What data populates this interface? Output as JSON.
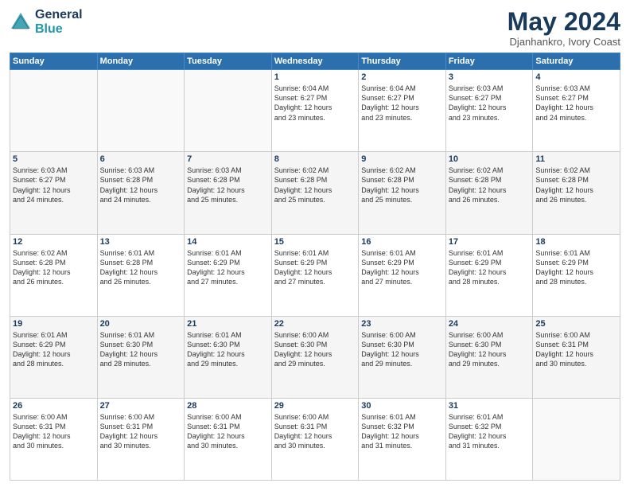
{
  "logo": {
    "line1": "General",
    "line2": "Blue"
  },
  "title": "May 2024",
  "subtitle": "Djanhankro, Ivory Coast",
  "days_header": [
    "Sunday",
    "Monday",
    "Tuesday",
    "Wednesday",
    "Thursday",
    "Friday",
    "Saturday"
  ],
  "weeks": [
    [
      {
        "day": "",
        "info": ""
      },
      {
        "day": "",
        "info": ""
      },
      {
        "day": "",
        "info": ""
      },
      {
        "day": "1",
        "info": "Sunrise: 6:04 AM\nSunset: 6:27 PM\nDaylight: 12 hours\nand 23 minutes."
      },
      {
        "day": "2",
        "info": "Sunrise: 6:04 AM\nSunset: 6:27 PM\nDaylight: 12 hours\nand 23 minutes."
      },
      {
        "day": "3",
        "info": "Sunrise: 6:03 AM\nSunset: 6:27 PM\nDaylight: 12 hours\nand 23 minutes."
      },
      {
        "day": "4",
        "info": "Sunrise: 6:03 AM\nSunset: 6:27 PM\nDaylight: 12 hours\nand 24 minutes."
      }
    ],
    [
      {
        "day": "5",
        "info": "Sunrise: 6:03 AM\nSunset: 6:27 PM\nDaylight: 12 hours\nand 24 minutes."
      },
      {
        "day": "6",
        "info": "Sunrise: 6:03 AM\nSunset: 6:28 PM\nDaylight: 12 hours\nand 24 minutes."
      },
      {
        "day": "7",
        "info": "Sunrise: 6:03 AM\nSunset: 6:28 PM\nDaylight: 12 hours\nand 25 minutes."
      },
      {
        "day": "8",
        "info": "Sunrise: 6:02 AM\nSunset: 6:28 PM\nDaylight: 12 hours\nand 25 minutes."
      },
      {
        "day": "9",
        "info": "Sunrise: 6:02 AM\nSunset: 6:28 PM\nDaylight: 12 hours\nand 25 minutes."
      },
      {
        "day": "10",
        "info": "Sunrise: 6:02 AM\nSunset: 6:28 PM\nDaylight: 12 hours\nand 26 minutes."
      },
      {
        "day": "11",
        "info": "Sunrise: 6:02 AM\nSunset: 6:28 PM\nDaylight: 12 hours\nand 26 minutes."
      }
    ],
    [
      {
        "day": "12",
        "info": "Sunrise: 6:02 AM\nSunset: 6:28 PM\nDaylight: 12 hours\nand 26 minutes."
      },
      {
        "day": "13",
        "info": "Sunrise: 6:01 AM\nSunset: 6:28 PM\nDaylight: 12 hours\nand 26 minutes."
      },
      {
        "day": "14",
        "info": "Sunrise: 6:01 AM\nSunset: 6:29 PM\nDaylight: 12 hours\nand 27 minutes."
      },
      {
        "day": "15",
        "info": "Sunrise: 6:01 AM\nSunset: 6:29 PM\nDaylight: 12 hours\nand 27 minutes."
      },
      {
        "day": "16",
        "info": "Sunrise: 6:01 AM\nSunset: 6:29 PM\nDaylight: 12 hours\nand 27 minutes."
      },
      {
        "day": "17",
        "info": "Sunrise: 6:01 AM\nSunset: 6:29 PM\nDaylight: 12 hours\nand 28 minutes."
      },
      {
        "day": "18",
        "info": "Sunrise: 6:01 AM\nSunset: 6:29 PM\nDaylight: 12 hours\nand 28 minutes."
      }
    ],
    [
      {
        "day": "19",
        "info": "Sunrise: 6:01 AM\nSunset: 6:29 PM\nDaylight: 12 hours\nand 28 minutes."
      },
      {
        "day": "20",
        "info": "Sunrise: 6:01 AM\nSunset: 6:30 PM\nDaylight: 12 hours\nand 28 minutes."
      },
      {
        "day": "21",
        "info": "Sunrise: 6:01 AM\nSunset: 6:30 PM\nDaylight: 12 hours\nand 29 minutes."
      },
      {
        "day": "22",
        "info": "Sunrise: 6:00 AM\nSunset: 6:30 PM\nDaylight: 12 hours\nand 29 minutes."
      },
      {
        "day": "23",
        "info": "Sunrise: 6:00 AM\nSunset: 6:30 PM\nDaylight: 12 hours\nand 29 minutes."
      },
      {
        "day": "24",
        "info": "Sunrise: 6:00 AM\nSunset: 6:30 PM\nDaylight: 12 hours\nand 29 minutes."
      },
      {
        "day": "25",
        "info": "Sunrise: 6:00 AM\nSunset: 6:31 PM\nDaylight: 12 hours\nand 30 minutes."
      }
    ],
    [
      {
        "day": "26",
        "info": "Sunrise: 6:00 AM\nSunset: 6:31 PM\nDaylight: 12 hours\nand 30 minutes."
      },
      {
        "day": "27",
        "info": "Sunrise: 6:00 AM\nSunset: 6:31 PM\nDaylight: 12 hours\nand 30 minutes."
      },
      {
        "day": "28",
        "info": "Sunrise: 6:00 AM\nSunset: 6:31 PM\nDaylight: 12 hours\nand 30 minutes."
      },
      {
        "day": "29",
        "info": "Sunrise: 6:00 AM\nSunset: 6:31 PM\nDaylight: 12 hours\nand 30 minutes."
      },
      {
        "day": "30",
        "info": "Sunrise: 6:01 AM\nSunset: 6:32 PM\nDaylight: 12 hours\nand 31 minutes."
      },
      {
        "day": "31",
        "info": "Sunrise: 6:01 AM\nSunset: 6:32 PM\nDaylight: 12 hours\nand 31 minutes."
      },
      {
        "day": "",
        "info": ""
      }
    ]
  ]
}
